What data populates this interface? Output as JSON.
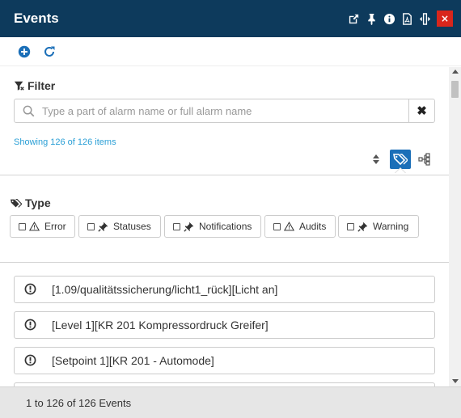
{
  "window": {
    "title": "Events",
    "title_icons": [
      "external-link-icon",
      "pin-icon",
      "info-icon",
      "pdf-icon",
      "resize-icon"
    ],
    "close_label": "×"
  },
  "toolbar": {
    "buttons": [
      "add-icon",
      "refresh-icon"
    ]
  },
  "filter": {
    "heading": "Filter",
    "search_placeholder": "Type a part of alarm name or full alarm name",
    "search_value": "",
    "clear_label": "✖",
    "showing_text": "Showing 126 of 126 items"
  },
  "type": {
    "heading": "Type",
    "buttons": [
      {
        "label": "Error",
        "icon": "warning-icon",
        "checked": false
      },
      {
        "label": "Statuses",
        "icon": "plug-icon",
        "checked": false
      },
      {
        "label": "Notifications",
        "icon": "plug-icon",
        "checked": false
      },
      {
        "label": "Audits",
        "icon": "warning-icon",
        "checked": false
      },
      {
        "label": "Warning",
        "icon": "plug-icon",
        "checked": false
      }
    ]
  },
  "events": [
    {
      "text": "[1.09/qualitätssicherung/licht1_rück][Licht an]",
      "icon": "exclamation-circle-icon"
    },
    {
      "text": "[Level 1][KR 201 Kompressordruck Greifer]",
      "icon": "exclamation-circle-icon"
    },
    {
      "text": "[Setpoint 1][KR 201 - Automode]",
      "icon": "exclamation-circle-icon"
    }
  ],
  "footer": {
    "text": "1 to 126 of 126 Events"
  },
  "colors": {
    "titlebar": "#0d3a5c",
    "close": "#d9261c",
    "accent": "#1b6fb8",
    "link": "#2a9fd6"
  }
}
